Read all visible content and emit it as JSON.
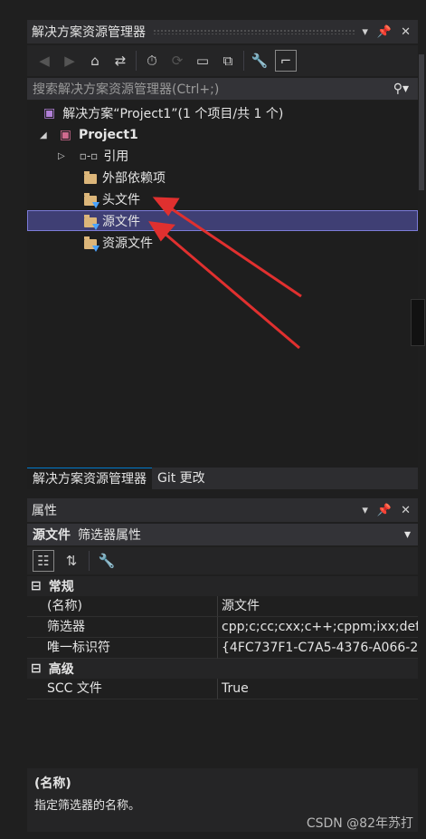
{
  "solution_explorer": {
    "title": "解决方案资源管理器",
    "search_placeholder": "搜索解决方案资源管理器(Ctrl+;)",
    "solution_label": "解决方案“Project1”(1 个项目/共 1 个)",
    "project_label": "Project1",
    "tree": [
      {
        "label": "引用"
      },
      {
        "label": "外部依赖项"
      },
      {
        "label": "头文件"
      },
      {
        "label": "源文件"
      },
      {
        "label": "资源文件"
      }
    ]
  },
  "bottom_tabs": [
    "解决方案资源管理器",
    "Git 更改"
  ],
  "properties": {
    "title": "属性",
    "selected_object": "源文件",
    "selected_type": "筛选器属性",
    "categories": [
      {
        "name": "常规",
        "rows": [
          {
            "name": "(名称)",
            "value": "源文件"
          },
          {
            "name": "筛选器",
            "value": "cpp;c;cc;cxx;c++;cppm;ixx;def"
          },
          {
            "name": "唯一标识符",
            "value": "{4FC737F1-C7A5-4376-A066-2"
          }
        ]
      },
      {
        "name": "高级",
        "rows": [
          {
            "name": "SCC 文件",
            "value": "True"
          }
        ]
      }
    ],
    "description_title": "(名称)",
    "description_text": "指定筛选器的名称。"
  },
  "watermark": "CSDN @82年苏打",
  "colors": {
    "arrow": "#e0302f",
    "selection": "#3f3f74",
    "accent": "#007acc"
  }
}
